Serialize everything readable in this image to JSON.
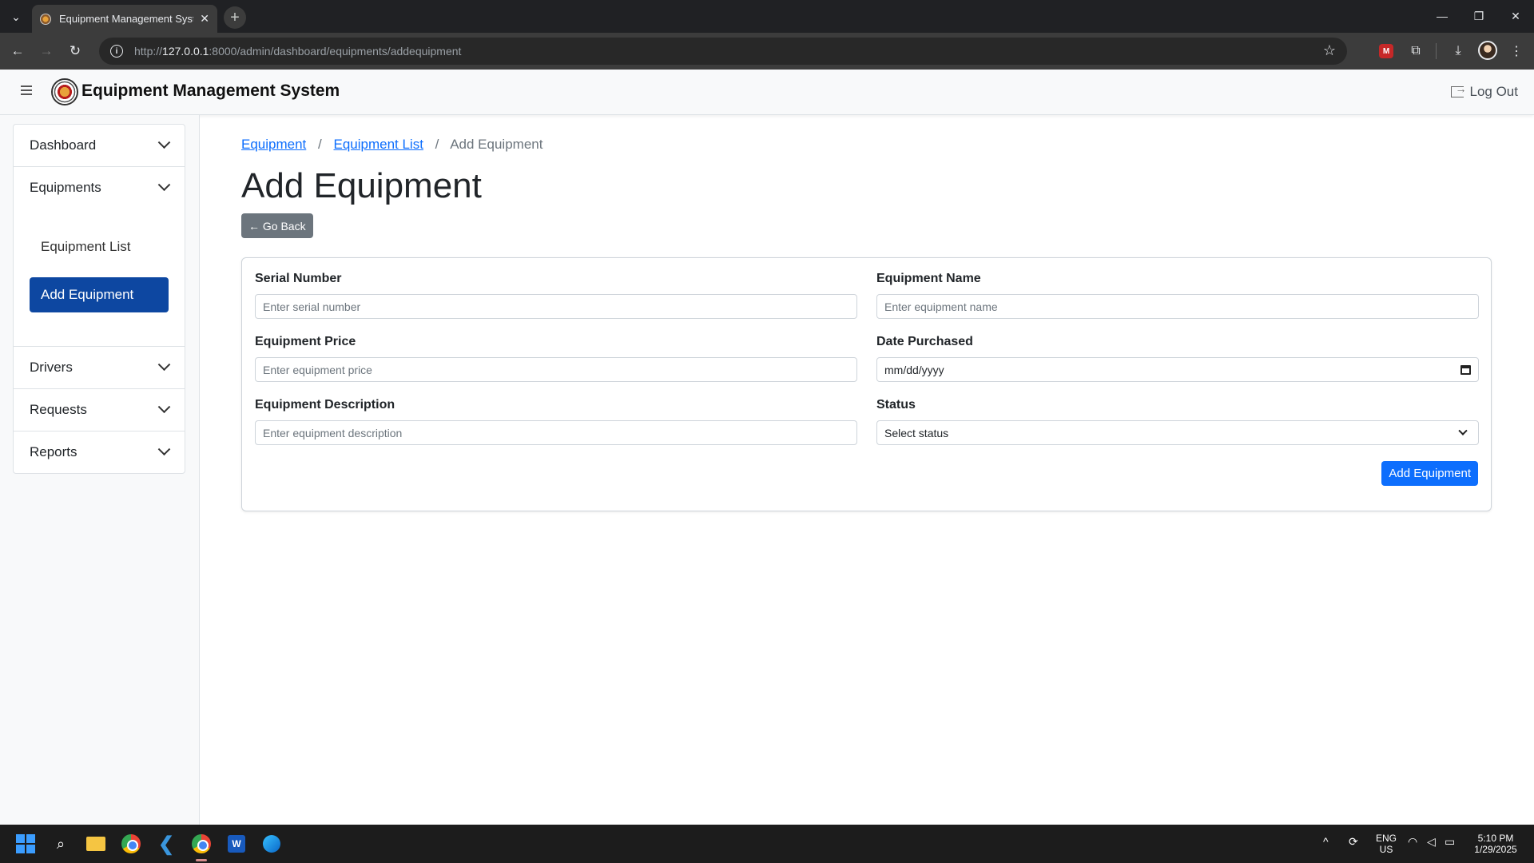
{
  "browser": {
    "tab_title": "Equipment Management System",
    "url_scheme": "http://",
    "url_host": "127.0.0.1",
    "url_rest": ":8000/admin/dashboard/equipments/addequipment"
  },
  "header": {
    "title": "Equipment Management System",
    "logout_label": "Log Out"
  },
  "sidebar": {
    "sections": [
      {
        "label": "Dashboard"
      },
      {
        "label": "Equipments",
        "items": [
          "Equipment List",
          "Add Equipment"
        ]
      },
      {
        "label": "Drivers"
      },
      {
        "label": "Requests"
      },
      {
        "label": "Reports"
      }
    ]
  },
  "breadcrumb": {
    "items": [
      "Equipment",
      "Equipment List"
    ],
    "current": "Add Equipment"
  },
  "page": {
    "title": "Add Equipment",
    "back_label": "← Go Back"
  },
  "form": {
    "serial_number": {
      "label": "Serial Number",
      "placeholder": "Enter serial number"
    },
    "equipment_name": {
      "label": "Equipment Name",
      "placeholder": "Enter equipment name"
    },
    "equipment_price": {
      "label": "Equipment Price",
      "placeholder": "Enter equipment price"
    },
    "date_purchased": {
      "label": "Date Purchased",
      "placeholder": "mm/dd/yyyy"
    },
    "equipment_description": {
      "label": "Equipment Description",
      "placeholder": "Enter equipment description"
    },
    "status": {
      "label": "Status",
      "selected": "Select status"
    },
    "submit_label": "Add Equipment"
  },
  "taskbar": {
    "lang_top": "ENG",
    "lang_bottom": "US",
    "time": "5:10 PM",
    "date": "1/29/2025"
  },
  "colors": {
    "primary": "#0d6efd",
    "sidebar_active": "#0d47a1",
    "secondary": "#6c757d"
  }
}
